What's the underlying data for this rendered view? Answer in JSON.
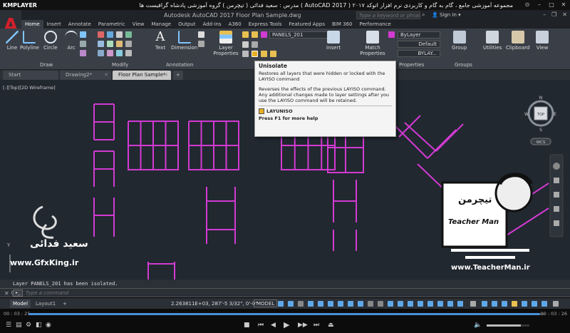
{
  "player": {
    "logo": "KMPLAYER",
    "title": "مجموعه آموزشی جامع ، گام به گام و کاربردی نرم افزار  اتوکد ۲۰۱۷ ( AutoCAD 2017 )   مدرس : سعید فدائی ( تیچرمن ) گروه آموزشی پادشاه گرافیست ها",
    "time_current": "00 : 03 : 25",
    "time_total": "00 : 03 : 26",
    "progress": 0.99,
    "volume": 0.8
  },
  "window": {
    "title": "Autodesk AutoCAD 2017    Floor Plan Sample.dwg",
    "search_placeholder": "Type a keyword or phrase",
    "signin_label": "Sign In"
  },
  "ribbon": {
    "tabs": [
      "Home",
      "Insert",
      "Annotate",
      "Parametric",
      "View",
      "Manage",
      "Output",
      "Add-ins",
      "A360",
      "Express Tools",
      "Featured Apps",
      "BIM 360",
      "Performance"
    ],
    "active_tab": "Home",
    "draw_buttons": [
      "Line",
      "Polyline",
      "Circle",
      "Arc"
    ],
    "text_label": "Text",
    "dimension_label": "Dimension",
    "layer_properties_label": "Layer\nProperties",
    "insert_label": "Insert",
    "match_properties_label": "Match\nProperties",
    "group_label": "Group",
    "utilities_label": "Utilities",
    "clipboard_label": "Clipboard",
    "view_label": "View",
    "layer_dropdown": "PANELS_201",
    "color_dropdown": "ByLayer",
    "linetype_dropdown": "Default",
    "lineweight_dropdown": "BYLAY...",
    "panel_titles": {
      "draw": "Draw",
      "modify": "Modify",
      "annotation": "Annotation",
      "properties": "Properties",
      "groups": "Groups"
    }
  },
  "tooltip": {
    "title": "Unisolate",
    "summary": "Restores all layers that were hidden or locked with the LAYISO command",
    "detail": "Reverses the effects of the previous LAYISO command. Any additional changes made to layer settings after you use the LAYISO command will be retained.",
    "command": "LAYUNISO",
    "help": "Press F1 for more help"
  },
  "file_tabs": {
    "start": "Start",
    "drawing2": "Drawing2*",
    "floor_plan": "Floor Plan Sample*",
    "add": "+"
  },
  "viewport": {
    "label": "[-][Top][2D Wireframe]",
    "viewcube_top": "TOP",
    "compass": {
      "n": "N",
      "s": "S",
      "e": "E",
      "w": "W"
    },
    "wcs": "WCS",
    "axis_y": "Y"
  },
  "watermark": {
    "left_name": "سعید فدائی",
    "left_site": "www.GfxKing.ir",
    "right_site": "www.TeacherMan.ir",
    "right_logo_text": "تیچرمن",
    "right_caption": "Teacher Man"
  },
  "command": {
    "history": "Layer PANELS_201 has been isolated.",
    "placeholder": "Type a command"
  },
  "status": {
    "model_tab": "Model",
    "layout_tab": "Layout1",
    "add_tab": "+",
    "coords": "2.263811E+03, 287'-5 3/32\", 0'-0\"",
    "model_button": "MODEL"
  },
  "colors": {
    "panel_magenta": "#d23ad2",
    "drawing_bg": "#212830",
    "ribbon_bg": "#3a3f47",
    "accent_red": "#d0202a"
  }
}
